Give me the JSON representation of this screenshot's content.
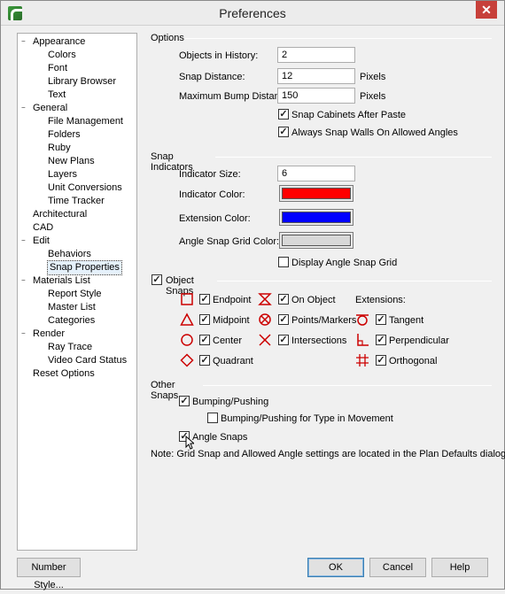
{
  "window": {
    "title": "Preferences",
    "close": "✕"
  },
  "tree": [
    {
      "label": "Appearance",
      "level": 0,
      "expander": "−"
    },
    {
      "label": "Colors",
      "level": 1
    },
    {
      "label": "Font",
      "level": 1
    },
    {
      "label": "Library Browser",
      "level": 1
    },
    {
      "label": "Text",
      "level": 1
    },
    {
      "label": "General",
      "level": 0,
      "expander": "−"
    },
    {
      "label": "File Management",
      "level": 1
    },
    {
      "label": "Folders",
      "level": 1
    },
    {
      "label": "Ruby",
      "level": 1
    },
    {
      "label": "New Plans",
      "level": 1
    },
    {
      "label": "Layers",
      "level": 1
    },
    {
      "label": "Unit Conversions",
      "level": 1
    },
    {
      "label": "Time Tracker",
      "level": 1
    },
    {
      "label": "Architectural",
      "level": 0
    },
    {
      "label": "CAD",
      "level": 0
    },
    {
      "label": "Edit",
      "level": 0,
      "expander": "−"
    },
    {
      "label": "Behaviors",
      "level": 1
    },
    {
      "label": "Snap Properties",
      "level": 1,
      "selected": true
    },
    {
      "label": "Materials List",
      "level": 0,
      "expander": "−"
    },
    {
      "label": "Report Style",
      "level": 1
    },
    {
      "label": "Master List",
      "level": 1
    },
    {
      "label": "Categories",
      "level": 1
    },
    {
      "label": "Render",
      "level": 0,
      "expander": "−"
    },
    {
      "label": "Ray Trace",
      "level": 1
    },
    {
      "label": "Video Card Status",
      "level": 1
    },
    {
      "label": "Reset Options",
      "level": 0
    }
  ],
  "options": {
    "title": "Options",
    "objects_in_history_label": "Objects in History:",
    "objects_in_history": "2",
    "snap_distance_label": "Snap Distance:",
    "snap_distance": "12",
    "snap_distance_unit": "Pixels",
    "max_bump_label": "Maximum Bump Distance:",
    "max_bump": "150",
    "max_bump_unit": "Pixels",
    "snap_cabinets_label": "Snap Cabinets After Paste",
    "snap_cabinets_checked": true,
    "snap_walls_label": "Always Snap Walls On Allowed Angles",
    "snap_walls_checked": true
  },
  "indicators": {
    "title": "Snap Indicators",
    "indicator_size_label": "Indicator Size:",
    "indicator_size": "6",
    "indicator_color_label": "Indicator Color:",
    "indicator_color": "#ff0000",
    "extension_color_label": "Extension Color:",
    "extension_color": "#0000ff",
    "angle_grid_color_label": "Angle Snap Grid Color:",
    "angle_grid_color": "#d8d8d8",
    "display_grid_label": "Display Angle Snap Grid",
    "display_grid_checked": false
  },
  "object_snaps": {
    "title": "Object Snaps",
    "checked": true,
    "extensions_label": "Extensions:",
    "icon_color": "#cc0000",
    "items": [
      {
        "label": "Endpoint",
        "icon": "square-icon",
        "checked": true
      },
      {
        "label": "Midpoint",
        "icon": "triangle-icon",
        "checked": true
      },
      {
        "label": "Center",
        "icon": "circle-icon",
        "checked": true
      },
      {
        "label": "Quadrant",
        "icon": "diamond-icon",
        "checked": true
      },
      {
        "label": "On Object",
        "icon": "hourglass-icon",
        "checked": true
      },
      {
        "label": "Points/Markers",
        "icon": "circle-x-icon",
        "checked": true
      },
      {
        "label": "Intersections",
        "icon": "x-icon",
        "checked": true
      },
      {
        "label": "Tangent",
        "icon": "tangent-icon",
        "checked": true
      },
      {
        "label": "Perpendicular",
        "icon": "perpendicular-icon",
        "checked": true
      },
      {
        "label": "Orthogonal",
        "icon": "orthogonal-icon",
        "checked": true
      }
    ]
  },
  "other_snaps": {
    "title": "Other Snaps",
    "bumping_label": "Bumping/Pushing",
    "bumping_checked": true,
    "bumping_type_label": "Bumping/Pushing for Type in Movement",
    "bumping_type_checked": false,
    "angle_snaps_label": "Angle Snaps",
    "angle_snaps_checked": true,
    "note": "Note: Grid Snap and Allowed Angle settings are located in the Plan Defaults dialog."
  },
  "buttons": {
    "number_style": "Number Style...",
    "ok": "OK",
    "cancel": "Cancel",
    "help": "Help"
  }
}
